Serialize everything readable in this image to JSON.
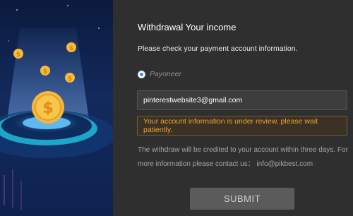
{
  "illustration": {
    "icon": "dollar-coin-icon"
  },
  "form": {
    "title": "Withdrawal Your income",
    "subtitle": "Please check your payment account information.",
    "payment_method": {
      "label": "Payoneer",
      "selected": true
    },
    "email_value": "pinterestwebsite3@gmail.com",
    "notice": "Your account information is under review, please wait patiently.",
    "info_line1": "The withdraw will be credited to your account within three days. For",
    "info_line2": "more information please contact us： info@pikbest.com",
    "submit_label": "SUBMIT"
  },
  "colors": {
    "panel_bg": "#2f2f2f",
    "notice_text": "#f0a32a",
    "radio_accent": "#3c8ce0",
    "button_bg": "#5b5b5b"
  }
}
